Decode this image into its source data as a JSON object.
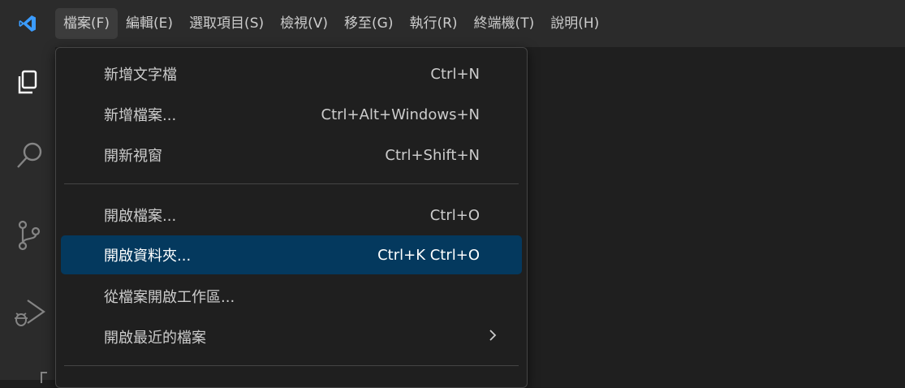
{
  "menubar": {
    "items": [
      {
        "label": "檔案(F)"
      },
      {
        "label": "編輯(E)"
      },
      {
        "label": "選取項目(S)"
      },
      {
        "label": "檢視(V)"
      },
      {
        "label": "移至(G)"
      },
      {
        "label": "執行(R)"
      },
      {
        "label": "終端機(T)"
      },
      {
        "label": "說明(H)"
      }
    ]
  },
  "file_menu": {
    "items": [
      {
        "label": "新增文字檔",
        "shortcut": "Ctrl+N"
      },
      {
        "label": "新增檔案...",
        "shortcut": "Ctrl+Alt+Windows+N"
      },
      {
        "label": "開新視窗",
        "shortcut": "Ctrl+Shift+N"
      },
      {
        "label": "開啟檔案...",
        "shortcut": "Ctrl+O"
      },
      {
        "label": "開啟資料夾...",
        "shortcut": "Ctrl+K Ctrl+O"
      },
      {
        "label": "從檔案開啟工作區...",
        "shortcut": ""
      },
      {
        "label": "開啟最近的檔案",
        "submenu_icon": "chevron-right-icon"
      }
    ]
  },
  "activity_bar": {
    "icons": [
      "explorer-icon",
      "search-icon",
      "source-control-icon",
      "run-debug-icon"
    ]
  },
  "colors": {
    "accent_logo": "#3b9cff",
    "highlight": "#04395e",
    "menubar_bg": "#2b2b2b",
    "editor_bg": "#1f1f1f"
  }
}
